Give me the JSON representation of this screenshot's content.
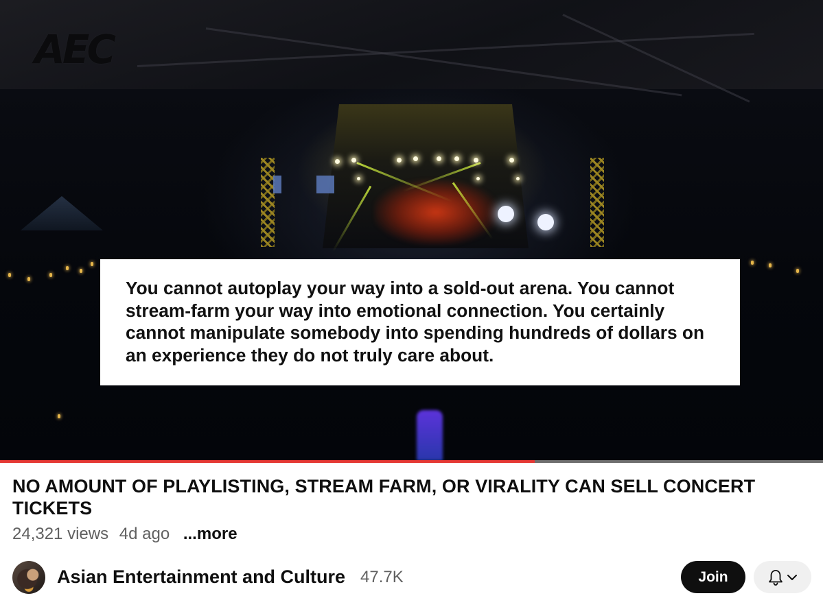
{
  "video": {
    "logo_text": "AEC",
    "quote": "You cannot autoplay your way into a sold-out arena. You cannot stream-farm your way into emotional connection. You certainly cannot manipulate somebody into spending hundreds of dollars on an experience they do not truly care about.",
    "progress_fraction": 0.65
  },
  "title": "NO AMOUNT OF PLAYLISTING, STREAM FARM, OR VIRALITY CAN SELL CONCERT TICKETS",
  "meta": {
    "views": "24,321 views",
    "age": "4d ago",
    "more_label": "...more"
  },
  "channel": {
    "name": "Asian Entertainment and Culture",
    "subscribers": "47.7K",
    "join_label": "Join",
    "bell_icon": "bell-icon",
    "chevron_icon": "chevron-down-icon"
  },
  "colors": {
    "progress_red": "#e53935",
    "progress_track": "#6f6f6f",
    "join_bg": "#0f0f0f",
    "bell_bg": "#f0f0f0",
    "meta_gray": "#606060"
  }
}
